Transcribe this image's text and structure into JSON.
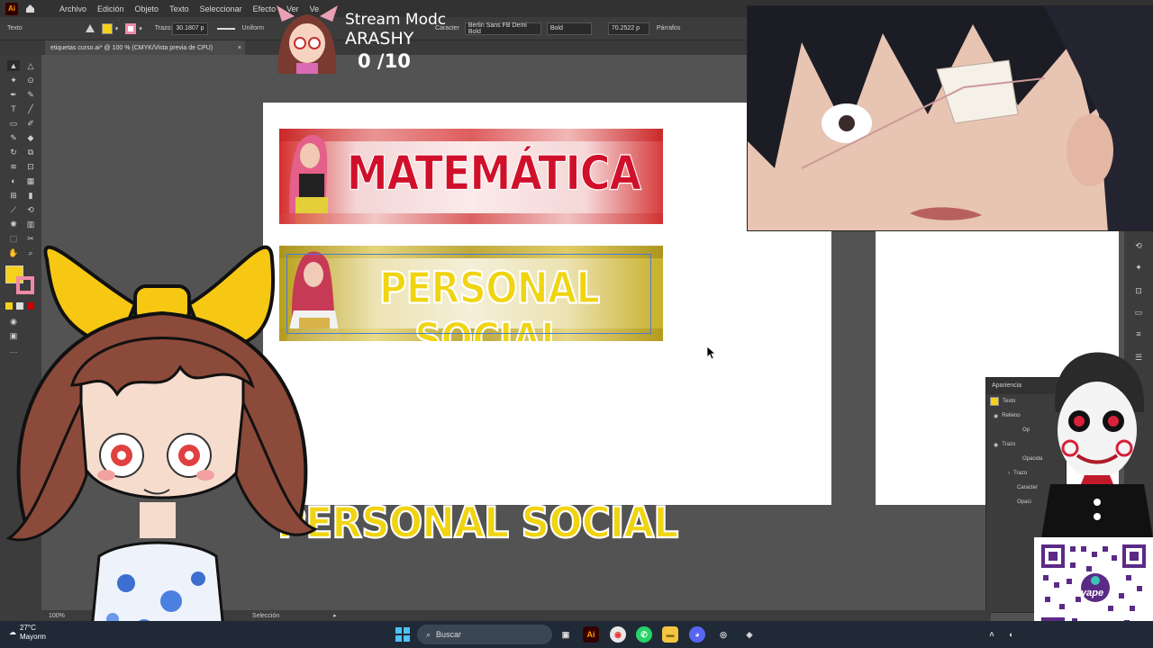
{
  "menubar": {
    "items": [
      "Archivo",
      "Edición",
      "Objeto",
      "Texto",
      "Seleccionar",
      "Efecto",
      "Ver",
      "Ve"
    ]
  },
  "controlbar": {
    "mode_label": "Texto",
    "stroke_label": "Trazo:",
    "stroke_value": "30.1807 p",
    "stroke_profile": "Uniform",
    "character_label": "Caracter",
    "font_name": "Berlin Sans FB Demi Bold",
    "font_style": "Bold",
    "font_size": "70.2522 p",
    "paragraph_label": "Párrafos"
  },
  "document_tab": {
    "title": "etiquetas curso.ai* @ 100 % (CMYK/Vista previa de CPU)",
    "close": "×"
  },
  "stream": {
    "mode": "Stream Modc",
    "name": "ARASHY",
    "count": "0  /10"
  },
  "banners": {
    "math": "MATEMÁTICA",
    "ps": "PERSONAL SOCIAL"
  },
  "canvas_overflow_text": "PERSONAL SOCIAL",
  "appearance_panel": {
    "title": "Apariencia",
    "rows": [
      "Texto",
      "Relleno",
      "Op",
      "Trazo",
      "Opacida",
      "Trazo",
      "Caracter",
      "Opaci"
    ]
  },
  "statusbar": {
    "zoom": "100%",
    "tool": "Selección"
  },
  "taskbar": {
    "temperature": "27°C",
    "weather_text": "Mayorm",
    "search_placeholder": "Buscar"
  },
  "qr": {
    "brand": "yape"
  },
  "colors": {
    "fill": "#f5d11c",
    "stroke": "#f08aa8",
    "math_text": "#d0102a",
    "ps_text": "#f0d410",
    "selection": "#4a7bd6"
  }
}
